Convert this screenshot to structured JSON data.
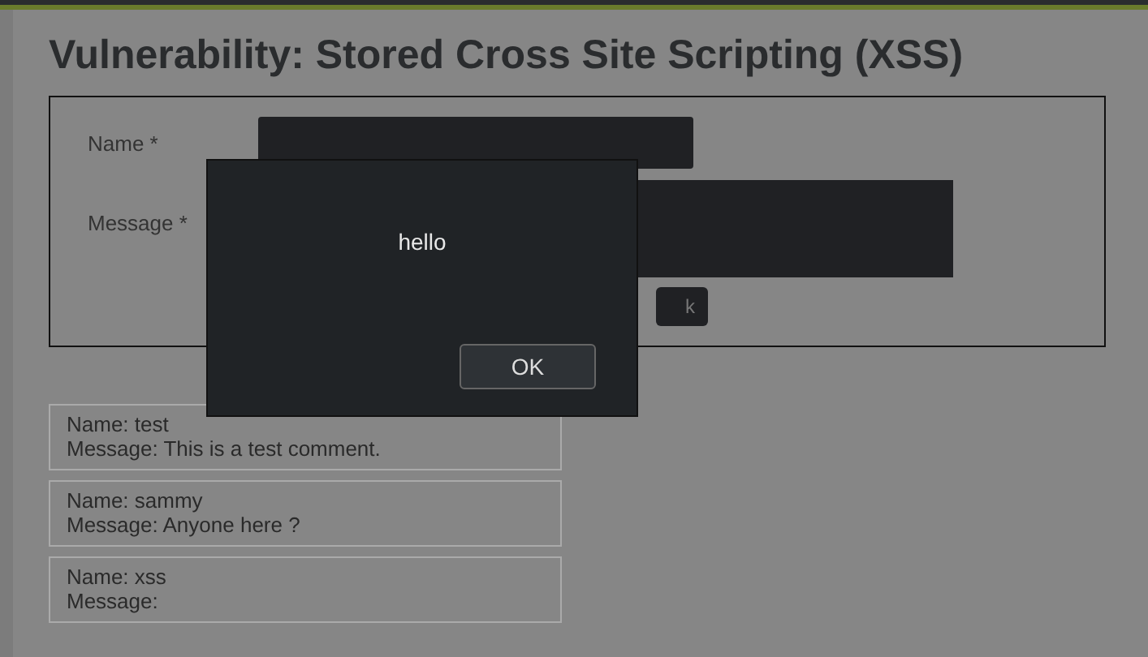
{
  "title": "Vulnerability: Stored Cross Site Scripting (XSS)",
  "form": {
    "fields": [
      {
        "label": "Name *",
        "kind": "input"
      },
      {
        "label": "Message *",
        "kind": "textarea"
      }
    ],
    "submit_label": "k"
  },
  "comments": [
    {
      "name": "Name: test",
      "message": "Message: This is a test comment."
    },
    {
      "name": "Name: sammy",
      "message": "Message: Anyone here ?"
    },
    {
      "name": "Name: xss",
      "message": "Message:"
    }
  ],
  "alert": {
    "message": "hello",
    "button": "OK"
  }
}
